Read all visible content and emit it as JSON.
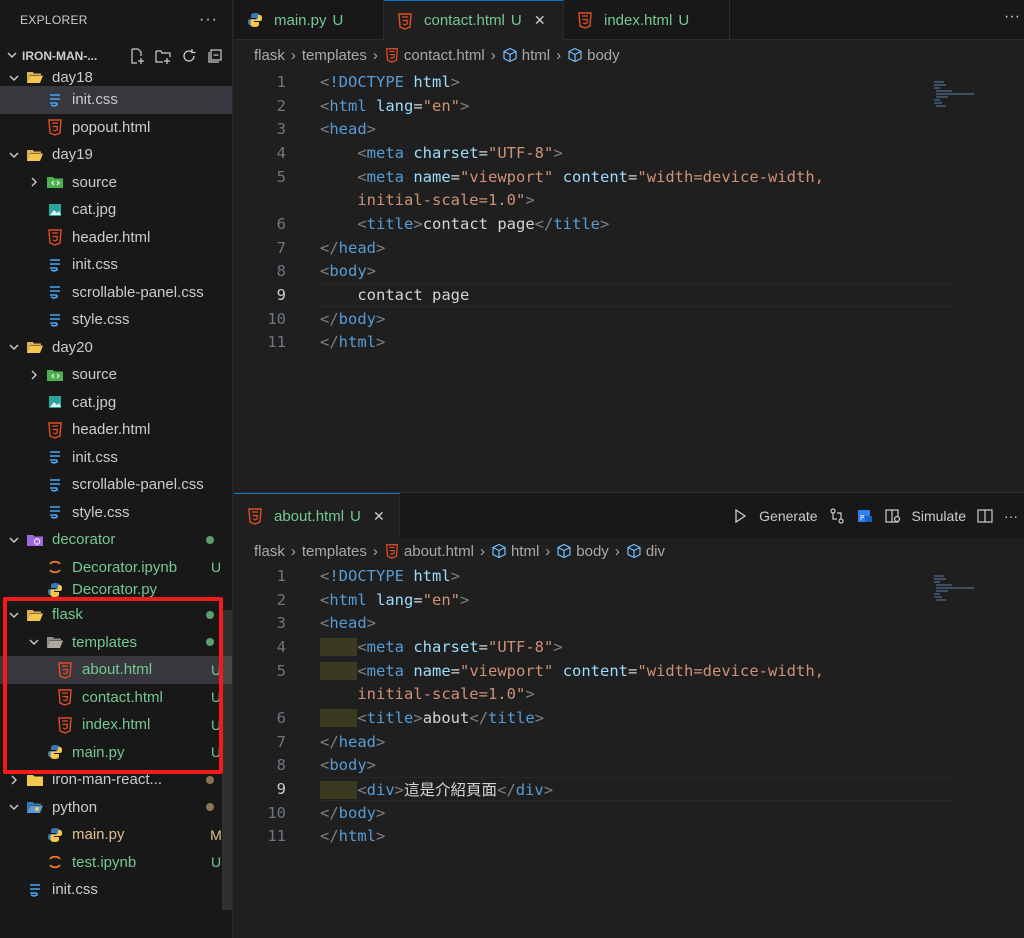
{
  "explorer": {
    "title": "EXPLORER",
    "more": "···",
    "root": "IRON-MAN-...",
    "items": [
      {
        "label": "day18",
        "type": "folder-open",
        "depth": 1,
        "chev": "down",
        "cut": true
      },
      {
        "label": "init.css",
        "type": "css",
        "depth": 2,
        "selected": true
      },
      {
        "label": "popout.html",
        "type": "html",
        "depth": 2
      },
      {
        "label": "day19",
        "type": "folder-open",
        "depth": 1,
        "chev": "down"
      },
      {
        "label": "source",
        "type": "folder-src",
        "depth": 2,
        "chev": "right"
      },
      {
        "label": "cat.jpg",
        "type": "image",
        "depth": 2
      },
      {
        "label": "header.html",
        "type": "html",
        "depth": 2
      },
      {
        "label": "init.css",
        "type": "css",
        "depth": 2
      },
      {
        "label": "scrollable-panel.css",
        "type": "css",
        "depth": 2
      },
      {
        "label": "style.css",
        "type": "css",
        "depth": 2
      },
      {
        "label": "day20",
        "type": "folder-open",
        "depth": 1,
        "chev": "down"
      },
      {
        "label": "source",
        "type": "folder-src",
        "depth": 2,
        "chev": "right"
      },
      {
        "label": "cat.jpg",
        "type": "image",
        "depth": 2
      },
      {
        "label": "header.html",
        "type": "html",
        "depth": 2
      },
      {
        "label": "init.css",
        "type": "css",
        "depth": 2
      },
      {
        "label": "scrollable-panel.css",
        "type": "css",
        "depth": 2
      },
      {
        "label": "style.css",
        "type": "css",
        "depth": 2
      },
      {
        "label": "decorator",
        "type": "folder-deco",
        "depth": 1,
        "chev": "down",
        "dot": true,
        "color": "git-u"
      },
      {
        "label": "Decorator.ipynb",
        "type": "ipynb",
        "depth": 2,
        "badge": "U",
        "color": "git-u"
      },
      {
        "label": "Decorator.py",
        "type": "python",
        "depth": 2,
        "color": "git-u",
        "cut": true
      },
      {
        "label": "flask",
        "type": "folder-open",
        "depth": 1,
        "chev": "down",
        "dot": true,
        "color": "git-u"
      },
      {
        "label": "templates",
        "type": "folder-tmpl",
        "depth": 2,
        "chev": "down",
        "dot": true,
        "color": "git-u"
      },
      {
        "label": "about.html",
        "type": "html",
        "depth": 3,
        "badge": "U",
        "color": "git-u",
        "selected": true
      },
      {
        "label": "contact.html",
        "type": "html",
        "depth": 3,
        "badge": "U",
        "color": "git-u"
      },
      {
        "label": "index.html",
        "type": "html",
        "depth": 3,
        "badge": "U",
        "color": "git-u"
      },
      {
        "label": "main.py",
        "type": "python",
        "depth": 2,
        "badge": "U",
        "color": "git-u"
      },
      {
        "label": "iron-man-react...",
        "type": "folder-closed",
        "depth": 1,
        "chev": "right",
        "dot": true,
        "color": "dot-m"
      },
      {
        "label": "python",
        "type": "folder-py",
        "depth": 1,
        "chev": "down",
        "dot": true,
        "color": "dot-m"
      },
      {
        "label": "main.py",
        "type": "python",
        "depth": 2,
        "badge": "M",
        "color": "git-m"
      },
      {
        "label": "test.ipynb",
        "type": "ipynb",
        "depth": 2,
        "badge": "U",
        "color": "git-u"
      },
      {
        "label": "init.css",
        "type": "css",
        "depth": 1
      }
    ]
  },
  "tabs": [
    {
      "label": "main.py",
      "mod": "U",
      "icon": "python",
      "active": false
    },
    {
      "label": "contact.html",
      "mod": "U",
      "icon": "html",
      "active": true,
      "close": "✕"
    },
    {
      "label": "index.html",
      "mod": "U",
      "icon": "html",
      "active": false
    }
  ],
  "tabs_more": "···",
  "pane1": {
    "breadcrumb": [
      "flask",
      "templates",
      "contact.html",
      "html",
      "body"
    ],
    "lines": [
      [
        [
          "tk-punct",
          "<"
        ],
        [
          "tk-doc",
          "!DOCTYPE"
        ],
        [
          "tk-text",
          " "
        ],
        [
          "tk-attr",
          "html"
        ],
        [
          "tk-punct",
          ">"
        ]
      ],
      [
        [
          "tk-punct",
          "<"
        ],
        [
          "tk-tag",
          "html"
        ],
        [
          "tk-text",
          " "
        ],
        [
          "tk-attr",
          "lang"
        ],
        [
          "tk-text",
          "="
        ],
        [
          "tk-str",
          "\"en\""
        ],
        [
          "tk-punct",
          ">"
        ]
      ],
      [
        [
          "tk-punct",
          "<"
        ],
        [
          "tk-tag",
          "head"
        ],
        [
          "tk-punct",
          ">"
        ]
      ],
      [
        [
          "tk-text",
          "    "
        ],
        [
          "tk-punct",
          "<"
        ],
        [
          "tk-tag",
          "meta"
        ],
        [
          "tk-text",
          " "
        ],
        [
          "tk-attr",
          "charset"
        ],
        [
          "tk-text",
          "="
        ],
        [
          "tk-str",
          "\"UTF-8\""
        ],
        [
          "tk-punct",
          ">"
        ]
      ],
      [
        [
          "tk-text",
          "    "
        ],
        [
          "tk-punct",
          "<"
        ],
        [
          "tk-tag",
          "meta"
        ],
        [
          "tk-text",
          " "
        ],
        [
          "tk-attr",
          "name"
        ],
        [
          "tk-text",
          "="
        ],
        [
          "tk-str",
          "\"viewport\""
        ],
        [
          "tk-text",
          " "
        ],
        [
          "tk-attr",
          "content"
        ],
        [
          "tk-text",
          "="
        ],
        [
          "tk-str",
          "\"width=device-width,"
        ]
      ],
      [
        [
          "tk-text",
          "    "
        ],
        [
          "tk-str",
          "initial-scale=1.0\""
        ],
        [
          "tk-punct",
          ">"
        ]
      ],
      [
        [
          "tk-text",
          "    "
        ],
        [
          "tk-punct",
          "<"
        ],
        [
          "tk-tag",
          "title"
        ],
        [
          "tk-punct",
          ">"
        ],
        [
          "tk-text",
          "contact page"
        ],
        [
          "tk-punct",
          "</"
        ],
        [
          "tk-tag",
          "title"
        ],
        [
          "tk-punct",
          ">"
        ]
      ],
      [
        [
          "tk-punct",
          "</"
        ],
        [
          "tk-tag",
          "head"
        ],
        [
          "tk-punct",
          ">"
        ]
      ],
      [
        [
          "tk-punct",
          "<"
        ],
        [
          "tk-tag",
          "body"
        ],
        [
          "tk-punct",
          ">"
        ]
      ],
      [
        [
          "tk-text",
          "    contact page"
        ]
      ],
      [
        [
          "tk-punct",
          "</"
        ],
        [
          "tk-tag",
          "body"
        ],
        [
          "tk-punct",
          ">"
        ]
      ],
      [
        [
          "tk-punct",
          "</"
        ],
        [
          "tk-tag",
          "html"
        ],
        [
          "tk-punct",
          ">"
        ]
      ]
    ],
    "line_numbers": [
      "1",
      "2",
      "3",
      "4",
      "5",
      "",
      "6",
      "7",
      "8",
      "9",
      "10",
      "11"
    ],
    "current_line": "9"
  },
  "pane2": {
    "tab": {
      "label": "about.html",
      "mod": "U",
      "close": "✕"
    },
    "actions": {
      "generate": "Generate",
      "simulate": "Simulate",
      "more": "···"
    },
    "breadcrumb": [
      "flask",
      "templates",
      "about.html",
      "html",
      "body",
      "div"
    ],
    "lines": [
      [
        [
          "tk-punct",
          "<"
        ],
        [
          "tk-doc",
          "!DOCTYPE"
        ],
        [
          "tk-text",
          " "
        ],
        [
          "tk-attr",
          "html"
        ],
        [
          "tk-punct",
          ">"
        ]
      ],
      [
        [
          "tk-punct",
          "<"
        ],
        [
          "tk-tag",
          "html"
        ],
        [
          "tk-text",
          " "
        ],
        [
          "tk-attr",
          "lang"
        ],
        [
          "tk-text",
          "="
        ],
        [
          "tk-str",
          "\"en\""
        ],
        [
          "tk-punct",
          ">"
        ]
      ],
      [
        [
          "tk-punct",
          "<"
        ],
        [
          "tk-tag",
          "head"
        ],
        [
          "tk-punct",
          ">"
        ]
      ],
      [
        [
          "ws",
          "    "
        ],
        [
          "tk-punct",
          "<"
        ],
        [
          "tk-tag",
          "meta"
        ],
        [
          "tk-text",
          " "
        ],
        [
          "tk-attr",
          "charset"
        ],
        [
          "tk-text",
          "="
        ],
        [
          "tk-str",
          "\"UTF-8\""
        ],
        [
          "tk-punct",
          ">"
        ]
      ],
      [
        [
          "ws",
          "    "
        ],
        [
          "tk-punct",
          "<"
        ],
        [
          "tk-tag",
          "meta"
        ],
        [
          "tk-text",
          " "
        ],
        [
          "tk-attr",
          "name"
        ],
        [
          "tk-text",
          "="
        ],
        [
          "tk-str",
          "\"viewport\""
        ],
        [
          "tk-text",
          " "
        ],
        [
          "tk-attr",
          "content"
        ],
        [
          "tk-text",
          "="
        ],
        [
          "tk-str",
          "\"width=device-width,"
        ]
      ],
      [
        [
          "tk-text",
          "    "
        ],
        [
          "tk-str",
          "initial-scale=1.0\""
        ],
        [
          "tk-punct",
          ">"
        ]
      ],
      [
        [
          "ws",
          "    "
        ],
        [
          "tk-punct",
          "<"
        ],
        [
          "tk-tag",
          "title"
        ],
        [
          "tk-punct",
          ">"
        ],
        [
          "tk-text",
          "about"
        ],
        [
          "tk-punct",
          "</"
        ],
        [
          "tk-tag",
          "title"
        ],
        [
          "tk-punct",
          ">"
        ]
      ],
      [
        [
          "tk-punct",
          "</"
        ],
        [
          "tk-tag",
          "head"
        ],
        [
          "tk-punct",
          ">"
        ]
      ],
      [
        [
          "tk-punct",
          "<"
        ],
        [
          "tk-tag",
          "body"
        ],
        [
          "tk-punct",
          ">"
        ]
      ],
      [
        [
          "ws",
          "    "
        ],
        [
          "tk-punct",
          "<"
        ],
        [
          "tk-tag",
          "div"
        ],
        [
          "tk-punct",
          ">"
        ],
        [
          "tk-text",
          "這是介紹頁面"
        ],
        [
          "tk-punct",
          "</"
        ],
        [
          "tk-tag",
          "div"
        ],
        [
          "tk-punct",
          ">"
        ]
      ],
      [
        [
          "tk-punct",
          "</"
        ],
        [
          "tk-tag",
          "body"
        ],
        [
          "tk-punct",
          ">"
        ]
      ],
      [
        [
          "tk-punct",
          "</"
        ],
        [
          "tk-tag",
          "html"
        ],
        [
          "tk-punct",
          ">"
        ]
      ]
    ],
    "line_numbers": [
      "1",
      "2",
      "3",
      "4",
      "5",
      "",
      "6",
      "7",
      "8",
      "9",
      "10",
      "11"
    ],
    "current_line": "9"
  },
  "colors": {
    "accent": "#0078d4",
    "highlight_box": "#f21b1b",
    "git_untracked": "#73c991",
    "git_modified": "#e2c08d"
  }
}
